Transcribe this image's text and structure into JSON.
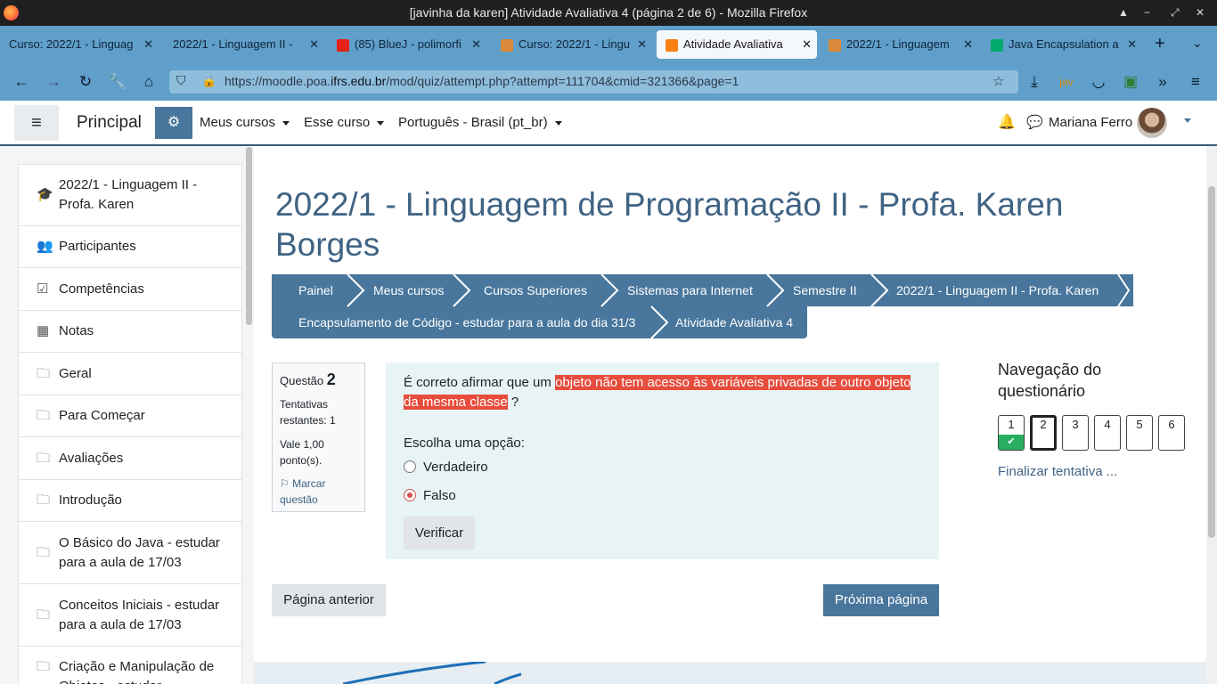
{
  "window": {
    "title": "[javinha da karen] Atividade Avaliativa 4 (página 2 de 6) - Mozilla Firefox"
  },
  "tabs": [
    {
      "label": "Curso: 2022/1 - Linguag"
    },
    {
      "label": "2022/1 - Linguagem II -"
    },
    {
      "label": "(85) BlueJ - polimorfi"
    },
    {
      "label": "Curso: 2022/1 - Lingu"
    },
    {
      "label": "Atividade Avaliativa"
    },
    {
      "label": "2022/1 - Linguagem"
    },
    {
      "label": "Java Encapsulation a"
    }
  ],
  "url": {
    "prefix": "https://moodle.poa.",
    "domain": "ifrs.edu.br",
    "path": "/mod/quiz/attempt.php?attempt=111704&cmid=321366&page=1"
  },
  "toolbar": {
    "ext_label": "jav"
  },
  "header": {
    "brand": "Principal",
    "menus": [
      "Meus cursos",
      "Esse curso",
      "Português - Brasil (pt_br)"
    ],
    "user": "Mariana Ferro"
  },
  "sidebar": {
    "items": [
      {
        "label": "2022/1 - Linguagem II - Profa. Karen",
        "icon": "graduation-cap-icon"
      },
      {
        "label": "Participantes",
        "icon": "users-icon"
      },
      {
        "label": "Competências",
        "icon": "checkbox-icon"
      },
      {
        "label": "Notas",
        "icon": "table-icon"
      },
      {
        "label": "Geral",
        "icon": "folder-icon"
      },
      {
        "label": "Para Começar",
        "icon": "folder-icon"
      },
      {
        "label": "Avaliações",
        "icon": "folder-icon"
      },
      {
        "label": "Introdução",
        "icon": "folder-icon"
      },
      {
        "label": "O Básico do Java - estudar para a aula de 17/03",
        "icon": "folder-icon"
      },
      {
        "label": "Conceitos Iniciais - estudar para a aula de 17/03",
        "icon": "folder-icon"
      },
      {
        "label": "Criação e Manipulação de Objetos - estudar",
        "icon": "folder-icon"
      }
    ]
  },
  "page": {
    "title": "2022/1 - Linguagem de Programação II - Profa. Karen Borges"
  },
  "breadcrumb": [
    "Painel",
    "Meus cursos",
    "Cursos Superiores",
    "Sistemas para Internet",
    "Semestre II",
    "2022/1 - Linguagem II - Profa. Karen",
    "Encapsulamento de Código - estudar para a aula do dia 31/3",
    "Atividade Avaliativa 4"
  ],
  "question": {
    "label": "Questão",
    "number": "2",
    "attempts": "Tentativas restantes: 1",
    "value": "Vale 1,00 ponto(s).",
    "flag": "Marcar questão",
    "text_before": "É correto afirmar que um ",
    "text_highlight": "objeto não tem acesso às variáveis privadas de outro objeto da mesma classe",
    "text_after": " ?",
    "prompt": "Escolha uma opção:",
    "options": [
      {
        "label": "Verdadeiro",
        "selected": false
      },
      {
        "label": "Falso",
        "selected": true
      }
    ],
    "verify": "Verificar"
  },
  "buttons": {
    "prev": "Página anterior",
    "next": "Próxima página"
  },
  "quiznav": {
    "title": "Navegação do questionário",
    "numbers": [
      "1",
      "2",
      "3",
      "4",
      "5",
      "6"
    ],
    "answered": [
      1
    ],
    "current": 2,
    "finish": "Finalizar tentativa ..."
  },
  "colors": {
    "accent": "#48769c",
    "title": "#3f6384",
    "answered": "#27ae60",
    "highlight": "#e74c3c"
  }
}
